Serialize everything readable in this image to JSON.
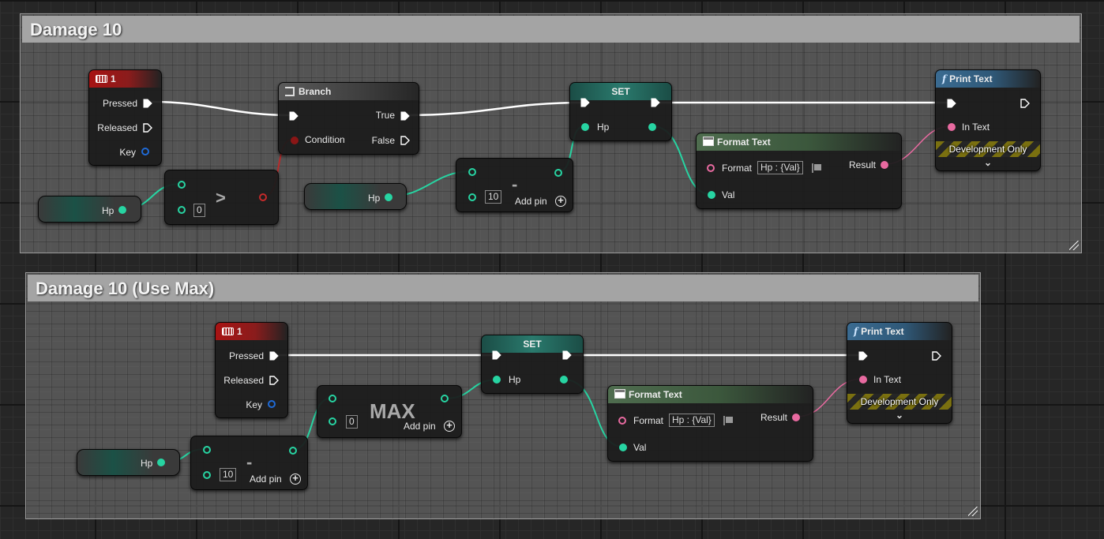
{
  "comment1": {
    "title": "Damage 10"
  },
  "comment2": {
    "title": "Damage 10 (Use Max)"
  },
  "labels": {
    "key_event_title": "1",
    "pressed": "Pressed",
    "released": "Released",
    "key": "Key",
    "branch_title": "Branch",
    "condition": "Condition",
    "true": "True",
    "false": "False",
    "set_title": "SET",
    "hp": "Hp",
    "format_text_title": "Format Text",
    "format": "Format",
    "format_value": "Hp : {Val}",
    "result": "Result",
    "val": "Val",
    "print_text_title": "Print Text",
    "in_text": "In Text",
    "development_only": "Development Only",
    "add_pin": "Add pin",
    "greater_op": ">",
    "subtract_op": "-",
    "max_op": "MAX",
    "zero": "0",
    "ten": "10"
  },
  "colors": {
    "float_pin": "#27d4a2",
    "bool_pin": "#b82a2a",
    "text_pin": "#e86aa0",
    "struct_pin": "#1f6ad6",
    "exec_wire": "#ffffff"
  },
  "icons": {
    "keyboard": "keyboard-icon",
    "function": "function-icon",
    "branch": "branch-icon",
    "format_text": "format-text-icon",
    "add": "add-pin-icon",
    "chevron": "chevron-down-icon",
    "flag": "flag-icon",
    "resize": "resize-handle-icon"
  }
}
